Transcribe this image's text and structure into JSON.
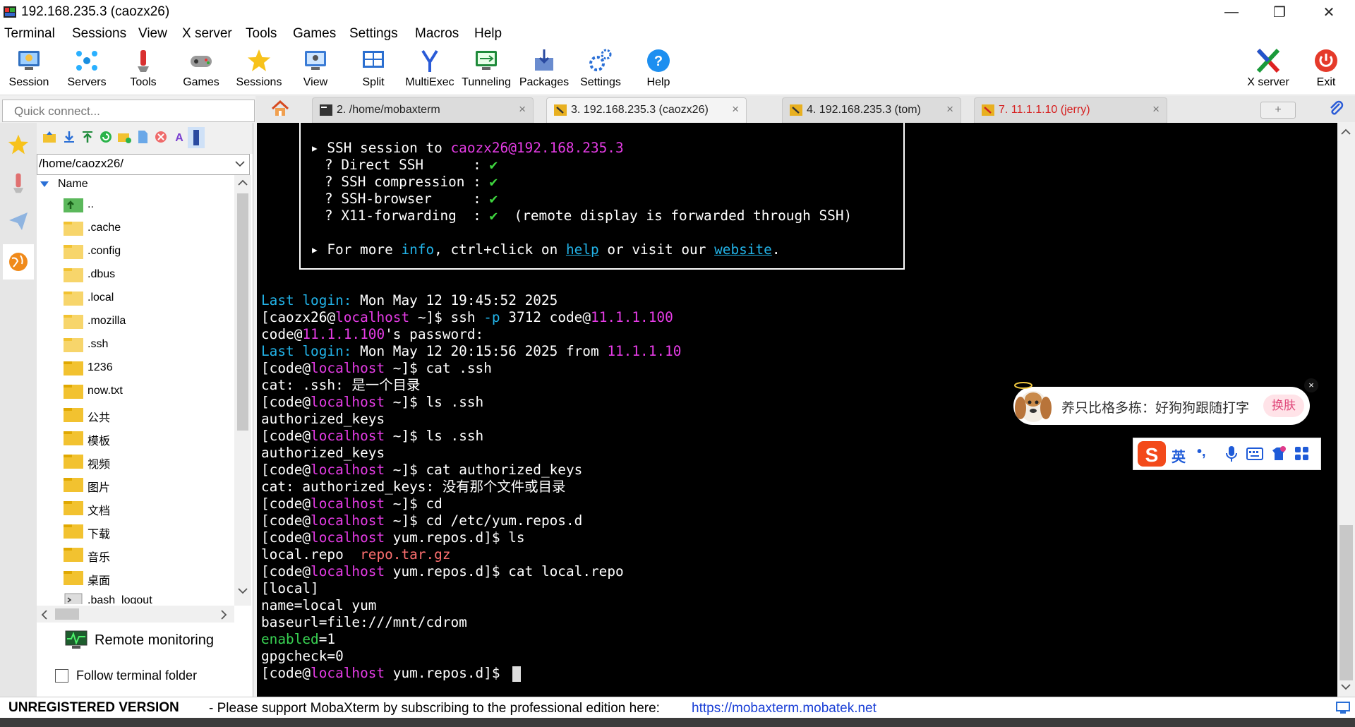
{
  "window": {
    "title": "192.168.235.3 (caozx26)"
  },
  "menu": [
    "Terminal",
    "Sessions",
    "View",
    "X server",
    "Tools",
    "Games",
    "Settings",
    "Macros",
    "Help"
  ],
  "toolbar": {
    "items": [
      {
        "label": "Session",
        "icon": "session-icon"
      },
      {
        "label": "Servers",
        "icon": "servers-icon"
      },
      {
        "label": "Tools",
        "icon": "tools-icon"
      },
      {
        "label": "Games",
        "icon": "games-icon"
      },
      {
        "label": "Sessions",
        "icon": "sessions-star-icon"
      },
      {
        "label": "View",
        "icon": "view-icon"
      },
      {
        "label": "Split",
        "icon": "split-icon"
      },
      {
        "label": "MultiExec",
        "icon": "multiexec-icon"
      },
      {
        "label": "Tunneling",
        "icon": "tunneling-icon"
      },
      {
        "label": "Packages",
        "icon": "packages-icon"
      },
      {
        "label": "Settings",
        "icon": "settings-icon"
      },
      {
        "label": "Help",
        "icon": "help-icon"
      }
    ],
    "xserver_label": "X server",
    "exit_label": "Exit"
  },
  "quick_connect": {
    "placeholder": "Quick connect..."
  },
  "tabs": [
    {
      "label": "2. /home/mobaxterm",
      "active": false,
      "color": "#222222"
    },
    {
      "label": "3. 192.168.235.3 (caozx26)",
      "active": true,
      "color": "#222222"
    },
    {
      "label": "4. 192.168.235.3 (tom)",
      "active": false,
      "color": "#222222"
    },
    {
      "label": "7. 11.1.1.10 (jerry)",
      "active": false,
      "color": "#d62020"
    }
  ],
  "file_browser": {
    "path": "/home/caozx26/",
    "column_name": "Name",
    "items": [
      "..",
      ".cache",
      ".config",
      ".dbus",
      ".local",
      ".mozilla",
      ".ssh",
      "1236",
      "now.txt",
      "公共",
      "模板",
      "视频",
      "图片",
      "文档",
      "下载",
      "音乐",
      "桌面",
      ".bash_logout"
    ],
    "remote_monitoring": "Remote monitoring",
    "follow_terminal": "Follow terminal folder",
    "follow_checked": false
  },
  "terminal": {
    "box": {
      "ssh_prefix": "SSH session to ",
      "ssh_target": "caozx26@192.168.235.3",
      "rows": [
        {
          "label": "? Direct SSH      :",
          "note": ""
        },
        {
          "label": "? SSH compression :",
          "note": ""
        },
        {
          "label": "? SSH-browser     :",
          "note": ""
        },
        {
          "label": "? X11-forwarding  :",
          "note": "  (remote display is forwarded through SSH)"
        }
      ],
      "check": "✔",
      "more_prefix": "For more ",
      "more_info": "info",
      "more_mid": ", ctrl+click on ",
      "more_help": "help",
      "more_mid2": " or visit our ",
      "more_website": "website",
      "more_end": "."
    },
    "last_login_label": "Last login:",
    "last_login_1": " Mon May 12 19:45:52 2025",
    "ssh_prompt_pre": "[caozx26@",
    "localhost": "localhost",
    "ssh_prompt_post": " ~]$ ssh ",
    "ssh_opt": "-p",
    "ssh_args": " 3712 code@",
    "ip_100": "11.1.1.100",
    "pw_pre": "code@",
    "pw_post": "'s password:",
    "last_login_2": " Mon May 12 20:15:56 2025 from ",
    "ip_10": "11.1.1.10",
    "code_prompt_pre": "[code@",
    "home_prompt_post": " ~]$ ",
    "repo_prompt_post": " yum.repos.d]$ ",
    "cmd_cat_ssh": "cat .ssh",
    "out_cat_ssh": "cat: .ssh: 是一个目录",
    "cmd_ls_ssh": "ls .ssh",
    "out_keys": "authorized_keys",
    "cmd_cat_keys": "cat authorized_keys",
    "out_cat_keys": "cat: authorized_keys: 没有那个文件或目录",
    "cmd_cd": "cd",
    "cmd_cd_repos": "cd /etc/yum.repos.d",
    "cmd_ls": "ls",
    "out_ls_1": "local.repo  ",
    "out_ls_2": "repo.tar.gz",
    "cmd_cat_repo": "cat local.repo",
    "repo_1": "[local]",
    "repo_2": "name=local yum",
    "repo_3": "baseurl=file:///mnt/cdrom",
    "repo_4_key": "enabled",
    "repo_4_val": "=1",
    "repo_5": "gpgcheck=0"
  },
  "popup": {
    "text": "养只比格多栋：好狗狗跟随打字",
    "button": "换肤",
    "close": "×"
  },
  "ime": {
    "lang": "英",
    "punct": "•,"
  },
  "status": {
    "unregistered": "UNREGISTERED VERSION",
    "message": "-  Please support MobaXterm by subscribing to the professional edition here:",
    "url": "https://mobaxterm.mobatek.net"
  },
  "colors": {
    "cyan": "#22b3e8",
    "magenta": "#e63ce6",
    "green": "#39d353",
    "salmon": "#ff7070",
    "link": "#1a3fd6"
  }
}
